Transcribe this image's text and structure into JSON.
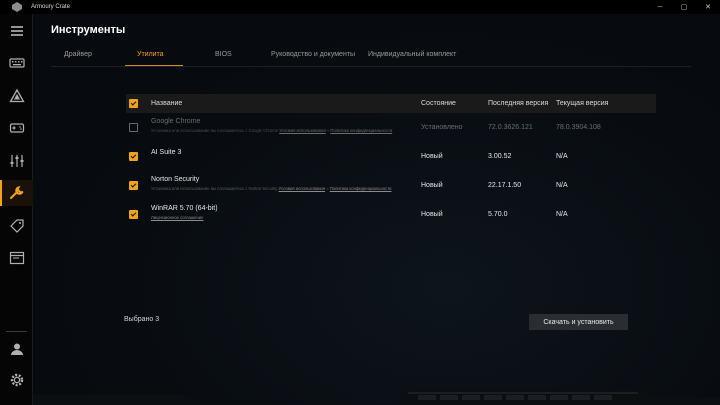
{
  "app": {
    "title": "Armoury Crate"
  },
  "window_controls": {
    "minimize": "─",
    "maximize": "▢",
    "close": "✕"
  },
  "page": {
    "title": "Инструменты"
  },
  "tabs": [
    {
      "label": "Драйвер",
      "active": false
    },
    {
      "label": "Утилита",
      "active": true
    },
    {
      "label": "BIOS",
      "active": false
    },
    {
      "label": "Руководство и документы",
      "active": false
    },
    {
      "label": "Индивидуальный комплект",
      "active": false
    }
  ],
  "table": {
    "headers": {
      "name": "Название",
      "status": "Состояние",
      "latest": "Последняя версия",
      "current": "Текущая версия"
    },
    "rows": [
      {
        "name": "Google Chrome",
        "note": "Установка или использование вы соглашаетесь с Google Chrome",
        "link1": "Условия использования",
        "sep": "»",
        "link2": "Политика конфиденциальности",
        "status": "Установлено",
        "latest": "72.0.3626.121",
        "current": "78.0.3904.108",
        "checked": false,
        "disabled": true
      },
      {
        "name": "AI Suite 3",
        "status": "Новый",
        "latest": "3.00.52",
        "current": "N/A",
        "checked": true,
        "disabled": false
      },
      {
        "name": "Norton Security",
        "note": "Установка или использование вы соглашаетесь с Norton Security",
        "link1": "Условия использования",
        "sep": "»",
        "link2": "Политика конфиденциальности",
        "status": "Новый",
        "latest": "22.17.1.50",
        "current": "N/A",
        "checked": true,
        "disabled": false
      },
      {
        "name": "WinRAR 5.70 (64-bit)",
        "link1": "Лицензионное соглашение",
        "status": "Новый",
        "latest": "5.70.0",
        "current": "N/A",
        "checked": true,
        "disabled": false
      }
    ]
  },
  "footer": {
    "selected": "Выбрано 3",
    "install_button": "Скачать и установить"
  },
  "colors": {
    "accent": "#f2a312",
    "background": "#070a0e",
    "button": "#2a2d31"
  },
  "sidebar_icons": [
    "menu-icon",
    "keyboard-icon",
    "aura-triangle-icon",
    "gamepad-icon",
    "sliders-icon",
    "wrench-icon",
    "tag-icon",
    "window-icon",
    "user-icon",
    "gear-icon"
  ]
}
